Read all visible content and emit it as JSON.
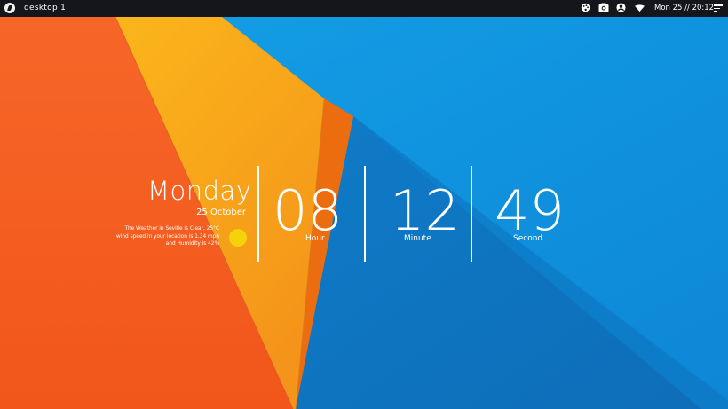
{
  "topbar": {
    "workspace": "desktop 1",
    "tray_icons": [
      "palette-icon",
      "camera-icon",
      "user-icon",
      "wifi-icon"
    ],
    "clock": "Mon 25 // 20:12",
    "menu_icon": "menu-icon"
  },
  "widget": {
    "day": "Monday",
    "date": "25 October",
    "weather_line1": "The Weather in Seville is Clear, 25°C",
    "weather_line2": "wind speed in your location is 1.34 mph",
    "weather_line3": "and Humidity is 42%",
    "hour": "08",
    "hour_label": "Hour",
    "minute": "12",
    "minute_label": "Minute",
    "second": "49",
    "second_label": "Second"
  },
  "colors": {
    "orange": "#f45f1f",
    "amber": "#f7a31a",
    "blue": "#1396e0",
    "sun": "#f5d20a"
  }
}
